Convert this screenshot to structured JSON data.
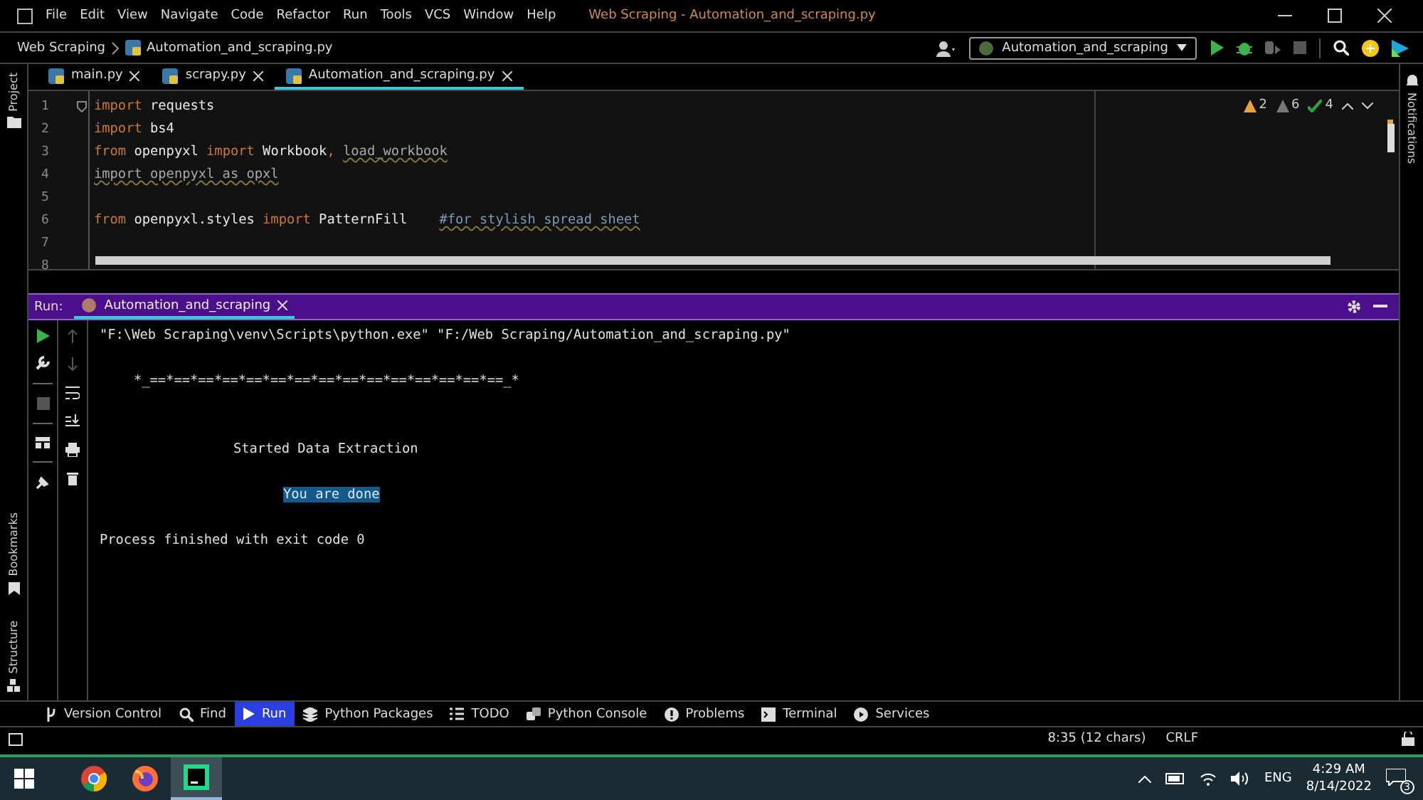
{
  "window": {
    "title": "Web Scraping - Automation_and_scraping.py"
  },
  "menu": [
    "File",
    "Edit",
    "View",
    "Navigate",
    "Code",
    "Refactor",
    "Run",
    "Tools",
    "VCS",
    "Window",
    "Help"
  ],
  "breadcrumb": [
    "Web Scraping",
    "Automation_and_scraping.py"
  ],
  "run_configuration": "Automation_and_scraping",
  "editor_tabs": [
    {
      "label": "main.py",
      "selected": false
    },
    {
      "label": "scrapy.py",
      "selected": false
    },
    {
      "label": "Automation_and_scraping.py",
      "selected": true
    }
  ],
  "inspections": [
    {
      "kind": "warning",
      "count": "2"
    },
    {
      "kind": "weak",
      "count": "6"
    },
    {
      "kind": "typo",
      "count": "4"
    }
  ],
  "code": [
    {
      "number": "1",
      "tokens": [
        {
          "text": "import",
          "kind": "keyword"
        },
        {
          "text": " requests",
          "kind": "plain"
        }
      ]
    },
    {
      "number": "2",
      "tokens": [
        {
          "text": "import",
          "kind": "keyword"
        },
        {
          "text": " bs4",
          "kind": "plain"
        }
      ]
    },
    {
      "number": "3",
      "tokens": [
        {
          "text": "from",
          "kind": "keyword"
        },
        {
          "text": " openpyxl ",
          "kind": "plain"
        },
        {
          "text": "import",
          "kind": "keyword"
        },
        {
          "text": " Workbook",
          "kind": "plain"
        },
        {
          "text": ", ",
          "kind": "keyword"
        },
        {
          "text": "load_workbook",
          "kind": "unused"
        }
      ]
    },
    {
      "number": "4",
      "tokens": [
        {
          "text": "import openpyxl as opxl",
          "kind": "unused"
        }
      ]
    },
    {
      "number": "5"
    },
    {
      "number": "6",
      "tokens": [
        {
          "text": "from",
          "kind": "keyword"
        },
        {
          "text": " openpyxl.styles ",
          "kind": "plain"
        },
        {
          "text": "import",
          "kind": "keyword"
        },
        {
          "text": " PatternFill    ",
          "kind": "plain"
        },
        {
          "text": "#for stylish spread sheet",
          "kind": "comment"
        }
      ]
    },
    {
      "number": "7"
    },
    {
      "number": "8"
    }
  ],
  "run_panel": {
    "label": "Run:",
    "tab": "Automation_and_scraping",
    "console": [
      {
        "kind": "command",
        "text": "\"F:\\Web Scraping\\venv\\Scripts\\python.exe\" \"F:/Web Scraping/Automation_and_scraping.py\"",
        "selected": false
      },
      {
        "kind": "banner",
        "text": "*_==*==*==*==*==*==*==*==*==*==*==*==*==*==*==_*",
        "selected": false
      },
      {
        "kind": "message",
        "text": "Started Data Extraction",
        "selected": false
      },
      {
        "kind": "result",
        "text": "You are done",
        "selected": true
      },
      {
        "kind": "exit",
        "text": "Process finished with exit code 0",
        "selected": false
      }
    ]
  },
  "side_tools": {
    "left_top": "Project",
    "left_bottom": [
      "Bookmarks",
      "Structure"
    ],
    "right": "Notifications"
  },
  "tool_windows": [
    {
      "label": "Version Control",
      "kind": "vcs",
      "selected": false
    },
    {
      "label": "Find",
      "kind": "find",
      "selected": false
    },
    {
      "label": "Run",
      "kind": "run",
      "selected": true
    },
    {
      "label": "Python Packages",
      "kind": "packages",
      "selected": false
    },
    {
      "label": "TODO",
      "kind": "todo",
      "selected": false
    },
    {
      "label": "Python Console",
      "kind": "console",
      "selected": false
    },
    {
      "label": "Problems",
      "kind": "problems",
      "selected": false
    },
    {
      "label": "Terminal",
      "kind": "terminal",
      "selected": false
    },
    {
      "label": "Services",
      "kind": "services",
      "selected": false
    }
  ],
  "status_bar": [
    "8:35 (12 chars)",
    "CRLF"
  ],
  "taskbar": {
    "apps": [
      {
        "kind": "browser",
        "selected": false
      },
      {
        "kind": "fox",
        "selected": false
      },
      {
        "kind": "ide",
        "selected": true
      }
    ],
    "language": "ENG",
    "time": "4:29 AM",
    "date": "8/14/2022",
    "notifications": "3"
  }
}
